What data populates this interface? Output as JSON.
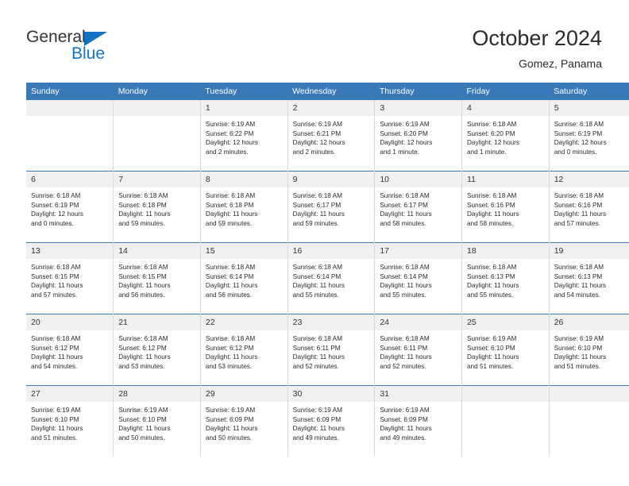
{
  "logo": {
    "word_top": "General",
    "word_bottom": "Blue",
    "triangle_color": "#1273c3"
  },
  "header": {
    "title": "October 2024",
    "subtitle": "Gomez, Panama"
  },
  "colors": {
    "header_blue": "#3a79b8",
    "daynum_band": "#f0f0f0",
    "logo_blue": "#1273c3"
  },
  "weekday_headers": [
    "Sunday",
    "Monday",
    "Tuesday",
    "Wednesday",
    "Thursday",
    "Friday",
    "Saturday"
  ],
  "weeks": [
    [
      {
        "day": "",
        "sunrise": "",
        "sunset": "",
        "daylight_line1": "",
        "daylight_line2": ""
      },
      {
        "day": "",
        "sunrise": "",
        "sunset": "",
        "daylight_line1": "",
        "daylight_line2": ""
      },
      {
        "day": "1",
        "sunrise": "Sunrise: 6:19 AM",
        "sunset": "Sunset: 6:22 PM",
        "daylight_line1": "Daylight: 12 hours",
        "daylight_line2": "and 2 minutes."
      },
      {
        "day": "2",
        "sunrise": "Sunrise: 6:19 AM",
        "sunset": "Sunset: 6:21 PM",
        "daylight_line1": "Daylight: 12 hours",
        "daylight_line2": "and 2 minutes."
      },
      {
        "day": "3",
        "sunrise": "Sunrise: 6:19 AM",
        "sunset": "Sunset: 6:20 PM",
        "daylight_line1": "Daylight: 12 hours",
        "daylight_line2": "and 1 minute."
      },
      {
        "day": "4",
        "sunrise": "Sunrise: 6:18 AM",
        "sunset": "Sunset: 6:20 PM",
        "daylight_line1": "Daylight: 12 hours",
        "daylight_line2": "and 1 minute."
      },
      {
        "day": "5",
        "sunrise": "Sunrise: 6:18 AM",
        "sunset": "Sunset: 6:19 PM",
        "daylight_line1": "Daylight: 12 hours",
        "daylight_line2": "and 0 minutes."
      }
    ],
    [
      {
        "day": "6",
        "sunrise": "Sunrise: 6:18 AM",
        "sunset": "Sunset: 6:19 PM",
        "daylight_line1": "Daylight: 12 hours",
        "daylight_line2": "and 0 minutes."
      },
      {
        "day": "7",
        "sunrise": "Sunrise: 6:18 AM",
        "sunset": "Sunset: 6:18 PM",
        "daylight_line1": "Daylight: 11 hours",
        "daylight_line2": "and 59 minutes."
      },
      {
        "day": "8",
        "sunrise": "Sunrise: 6:18 AM",
        "sunset": "Sunset: 6:18 PM",
        "daylight_line1": "Daylight: 11 hours",
        "daylight_line2": "and 59 minutes."
      },
      {
        "day": "9",
        "sunrise": "Sunrise: 6:18 AM",
        "sunset": "Sunset: 6:17 PM",
        "daylight_line1": "Daylight: 11 hours",
        "daylight_line2": "and 59 minutes."
      },
      {
        "day": "10",
        "sunrise": "Sunrise: 6:18 AM",
        "sunset": "Sunset: 6:17 PM",
        "daylight_line1": "Daylight: 11 hours",
        "daylight_line2": "and 58 minutes."
      },
      {
        "day": "11",
        "sunrise": "Sunrise: 6:18 AM",
        "sunset": "Sunset: 6:16 PM",
        "daylight_line1": "Daylight: 11 hours",
        "daylight_line2": "and 58 minutes."
      },
      {
        "day": "12",
        "sunrise": "Sunrise: 6:18 AM",
        "sunset": "Sunset: 6:16 PM",
        "daylight_line1": "Daylight: 11 hours",
        "daylight_line2": "and 57 minutes."
      }
    ],
    [
      {
        "day": "13",
        "sunrise": "Sunrise: 6:18 AM",
        "sunset": "Sunset: 6:15 PM",
        "daylight_line1": "Daylight: 11 hours",
        "daylight_line2": "and 57 minutes."
      },
      {
        "day": "14",
        "sunrise": "Sunrise: 6:18 AM",
        "sunset": "Sunset: 6:15 PM",
        "daylight_line1": "Daylight: 11 hours",
        "daylight_line2": "and 56 minutes."
      },
      {
        "day": "15",
        "sunrise": "Sunrise: 6:18 AM",
        "sunset": "Sunset: 6:14 PM",
        "daylight_line1": "Daylight: 11 hours",
        "daylight_line2": "and 56 minutes."
      },
      {
        "day": "16",
        "sunrise": "Sunrise: 6:18 AM",
        "sunset": "Sunset: 6:14 PM",
        "daylight_line1": "Daylight: 11 hours",
        "daylight_line2": "and 55 minutes."
      },
      {
        "day": "17",
        "sunrise": "Sunrise: 6:18 AM",
        "sunset": "Sunset: 6:14 PM",
        "daylight_line1": "Daylight: 11 hours",
        "daylight_line2": "and 55 minutes."
      },
      {
        "day": "18",
        "sunrise": "Sunrise: 6:18 AM",
        "sunset": "Sunset: 6:13 PM",
        "daylight_line1": "Daylight: 11 hours",
        "daylight_line2": "and 55 minutes."
      },
      {
        "day": "19",
        "sunrise": "Sunrise: 6:18 AM",
        "sunset": "Sunset: 6:13 PM",
        "daylight_line1": "Daylight: 11 hours",
        "daylight_line2": "and 54 minutes."
      }
    ],
    [
      {
        "day": "20",
        "sunrise": "Sunrise: 6:18 AM",
        "sunset": "Sunset: 6:12 PM",
        "daylight_line1": "Daylight: 11 hours",
        "daylight_line2": "and 54 minutes."
      },
      {
        "day": "21",
        "sunrise": "Sunrise: 6:18 AM",
        "sunset": "Sunset: 6:12 PM",
        "daylight_line1": "Daylight: 11 hours",
        "daylight_line2": "and 53 minutes."
      },
      {
        "day": "22",
        "sunrise": "Sunrise: 6:18 AM",
        "sunset": "Sunset: 6:12 PM",
        "daylight_line1": "Daylight: 11 hours",
        "daylight_line2": "and 53 minutes."
      },
      {
        "day": "23",
        "sunrise": "Sunrise: 6:18 AM",
        "sunset": "Sunset: 6:11 PM",
        "daylight_line1": "Daylight: 11 hours",
        "daylight_line2": "and 52 minutes."
      },
      {
        "day": "24",
        "sunrise": "Sunrise: 6:18 AM",
        "sunset": "Sunset: 6:11 PM",
        "daylight_line1": "Daylight: 11 hours",
        "daylight_line2": "and 52 minutes."
      },
      {
        "day": "25",
        "sunrise": "Sunrise: 6:19 AM",
        "sunset": "Sunset: 6:10 PM",
        "daylight_line1": "Daylight: 11 hours",
        "daylight_line2": "and 51 minutes."
      },
      {
        "day": "26",
        "sunrise": "Sunrise: 6:19 AM",
        "sunset": "Sunset: 6:10 PM",
        "daylight_line1": "Daylight: 11 hours",
        "daylight_line2": "and 51 minutes."
      }
    ],
    [
      {
        "day": "27",
        "sunrise": "Sunrise: 6:19 AM",
        "sunset": "Sunset: 6:10 PM",
        "daylight_line1": "Daylight: 11 hours",
        "daylight_line2": "and 51 minutes."
      },
      {
        "day": "28",
        "sunrise": "Sunrise: 6:19 AM",
        "sunset": "Sunset: 6:10 PM",
        "daylight_line1": "Daylight: 11 hours",
        "daylight_line2": "and 50 minutes."
      },
      {
        "day": "29",
        "sunrise": "Sunrise: 6:19 AM",
        "sunset": "Sunset: 6:09 PM",
        "daylight_line1": "Daylight: 11 hours",
        "daylight_line2": "and 50 minutes."
      },
      {
        "day": "30",
        "sunrise": "Sunrise: 6:19 AM",
        "sunset": "Sunset: 6:09 PM",
        "daylight_line1": "Daylight: 11 hours",
        "daylight_line2": "and 49 minutes."
      },
      {
        "day": "31",
        "sunrise": "Sunrise: 6:19 AM",
        "sunset": "Sunset: 6:09 PM",
        "daylight_line1": "Daylight: 11 hours",
        "daylight_line2": "and 49 minutes."
      },
      {
        "day": "",
        "sunrise": "",
        "sunset": "",
        "daylight_line1": "",
        "daylight_line2": ""
      },
      {
        "day": "",
        "sunrise": "",
        "sunset": "",
        "daylight_line1": "",
        "daylight_line2": ""
      }
    ]
  ]
}
